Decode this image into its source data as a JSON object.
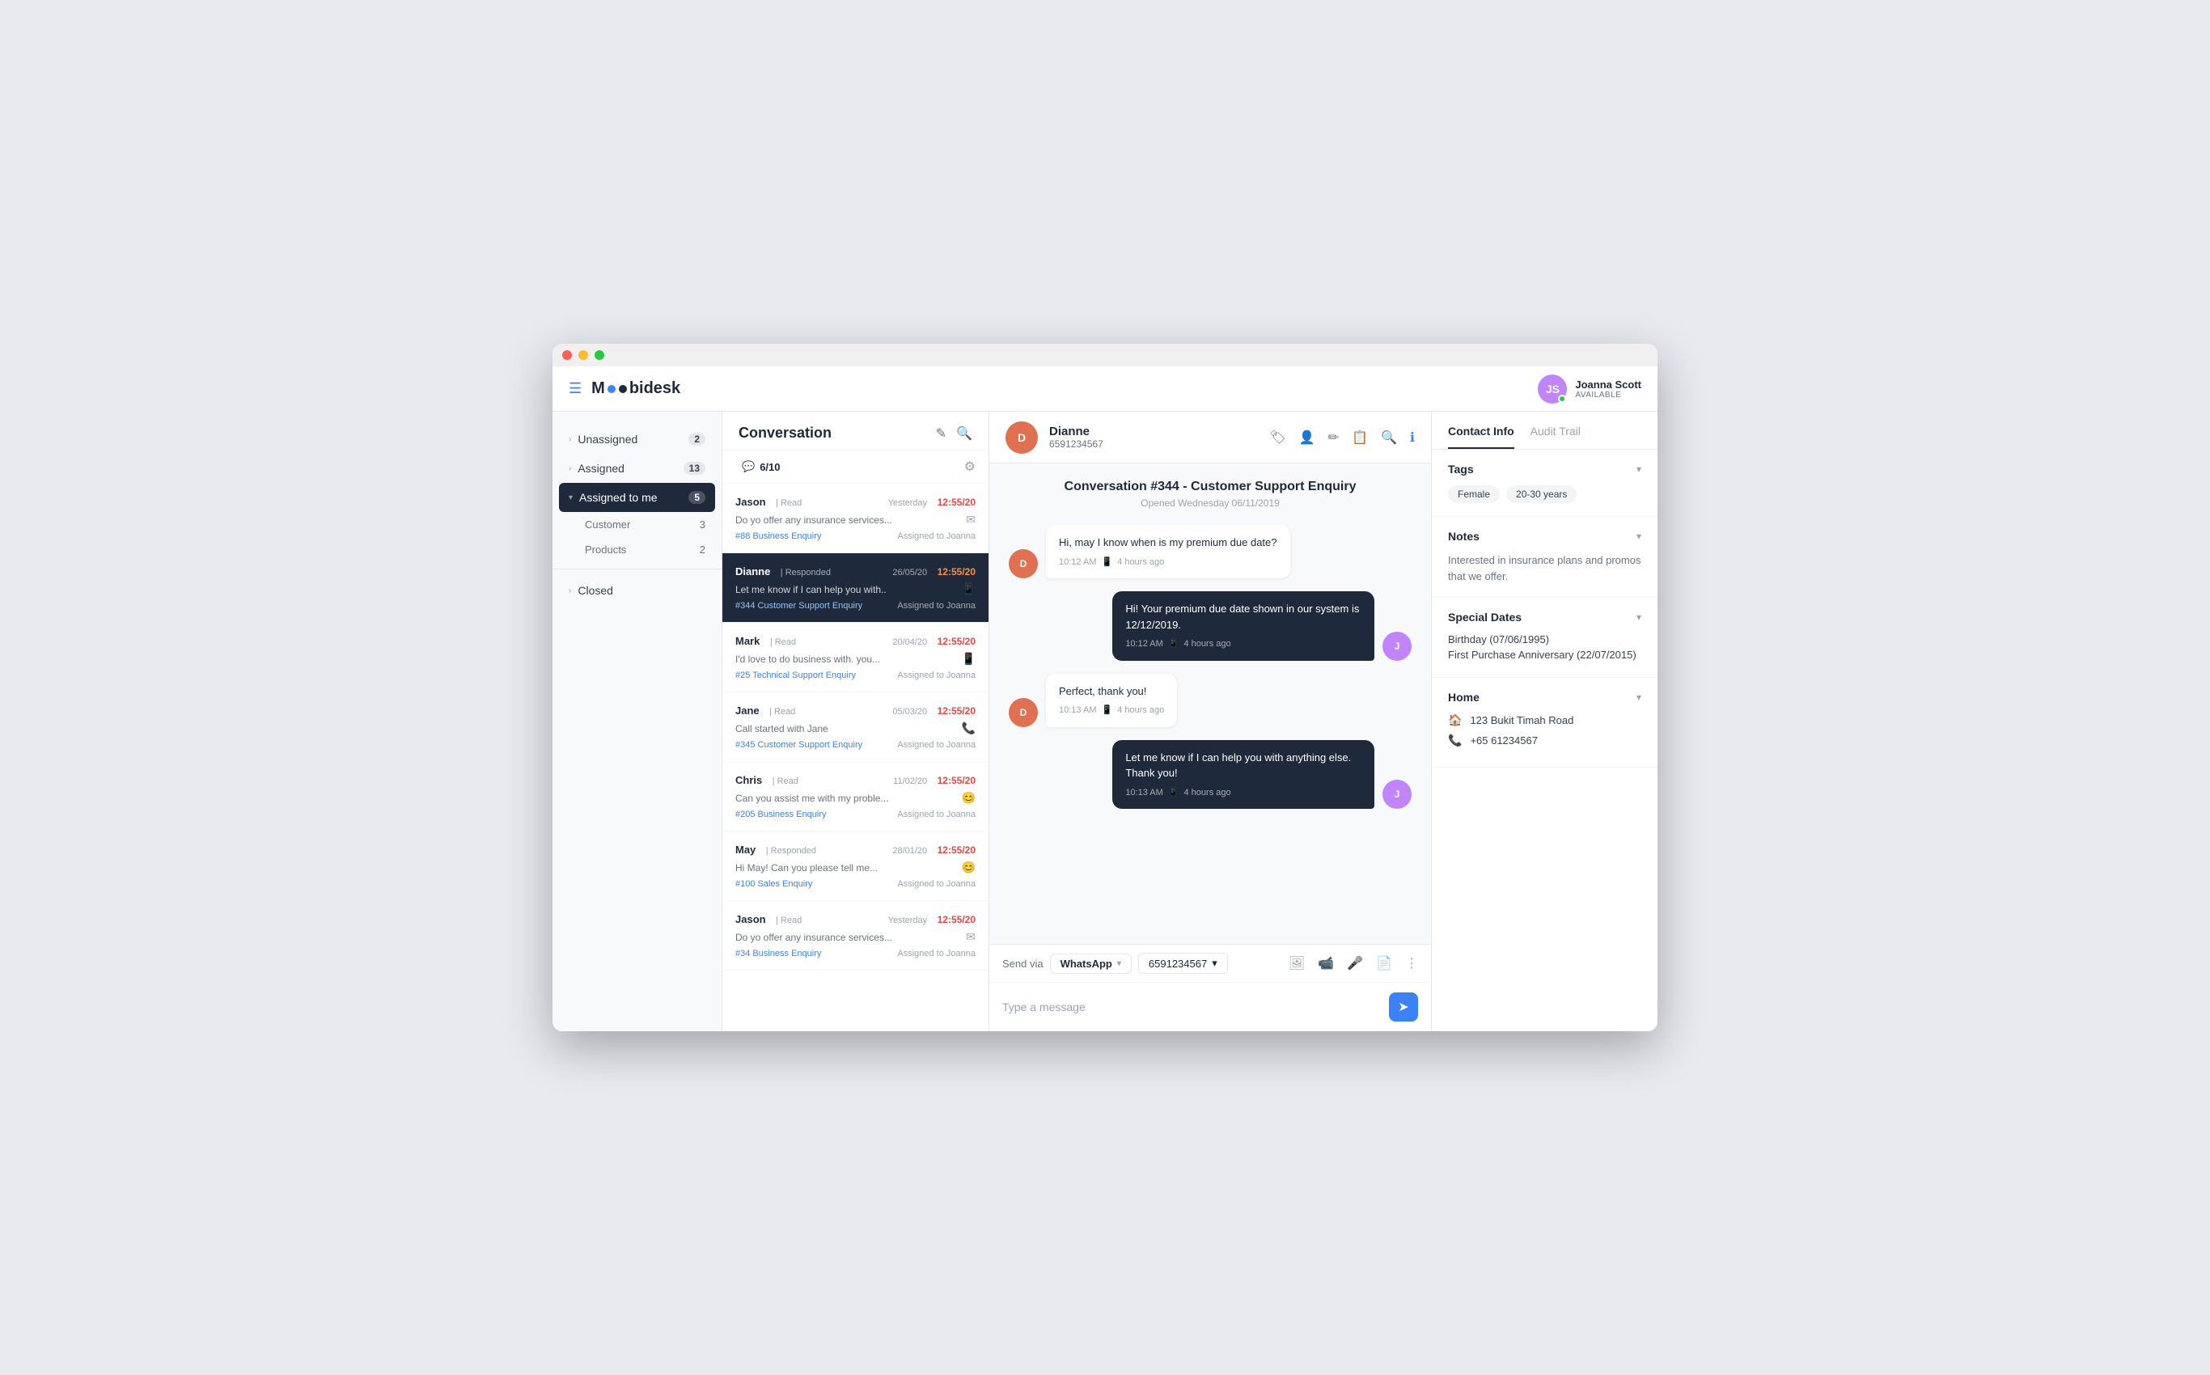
{
  "window": {
    "title": "Moobidesk"
  },
  "header": {
    "logo_text": "Moobidesk",
    "user_name": "Joanna Scott",
    "user_status": "AVAILABLE",
    "user_initials": "JS"
  },
  "sidebar": {
    "items": [
      {
        "id": "unassigned",
        "label": "Unassigned",
        "count": "2",
        "active": false
      },
      {
        "id": "assigned",
        "label": "Assigned",
        "count": "13",
        "active": false
      },
      {
        "id": "assigned-to-me",
        "label": "Assigned to me",
        "count": "5",
        "active": true
      },
      {
        "id": "closed",
        "label": "Closed",
        "count": "",
        "active": false
      }
    ],
    "sub_items": [
      {
        "id": "customer",
        "label": "Customer",
        "count": "3"
      },
      {
        "id": "products",
        "label": "Products",
        "count": "2"
      }
    ]
  },
  "conversation_list": {
    "title": "Conversation",
    "tab_count": "6/10",
    "items": [
      {
        "id": "conv-1",
        "name": "Jason",
        "status": "Read",
        "date": "Yesterday",
        "time": "12:55/20",
        "preview": "Do yo offer any insurance services...",
        "icon": "email",
        "tag": "#88 Business Enquiry",
        "assigned": "Assigned to Joanna",
        "selected": false
      },
      {
        "id": "conv-2",
        "name": "Dianne",
        "status": "Responded",
        "date": "26/05/20",
        "time": "12:55/20",
        "preview": "Let me know if I can help you with..",
        "icon": "whatsapp",
        "tag": "#344 Customer Support Enquiry",
        "assigned": "Assigned to Joanna",
        "selected": true
      },
      {
        "id": "conv-3",
        "name": "Mark",
        "status": "Read",
        "date": "20/04/20",
        "time": "12:55/20",
        "preview": "I'd love to do business with. you...",
        "icon": "phone",
        "tag": "#25 Technical Support Enquiry",
        "assigned": "Assigned to Joanna",
        "selected": false
      },
      {
        "id": "conv-4",
        "name": "Jane",
        "status": "Read",
        "date": "05/03/20",
        "time": "12:55/20",
        "preview": "Call started with Jane",
        "icon": "phone",
        "tag": "#345 Customer Support Enquiry",
        "assigned": "Assigned to Joanna",
        "selected": false
      },
      {
        "id": "conv-5",
        "name": "Chris",
        "status": "Read",
        "date": "11/02/20",
        "time": "12:55/20",
        "preview": "Can you assist me with my proble...",
        "icon": "emoji",
        "tag": "#205 Business Enquiry",
        "assigned": "Assigned to Joanna",
        "selected": false
      },
      {
        "id": "conv-6",
        "name": "May",
        "status": "Responded",
        "date": "28/01/20",
        "time": "12:55/20",
        "preview": "Hi May! Can you please tell me...",
        "icon": "emoji",
        "tag": "#100 Sales Enquiry",
        "assigned": "Assigned to Joanna",
        "selected": false
      },
      {
        "id": "conv-7",
        "name": "Jason",
        "status": "Read",
        "date": "Yesterday",
        "time": "12:55/20",
        "preview": "Do yo offer any insurance services...",
        "icon": "email",
        "tag": "#34 Business Enquiry",
        "assigned": "Assigned to Joanna",
        "selected": false
      }
    ]
  },
  "chat": {
    "contact_name": "Dianne",
    "contact_phone": "6591234567",
    "contact_initials": "D",
    "conversation_title": "Conversation #344 - Customer Support Enquiry",
    "conversation_date": "Opened Wednesday 06/11/2019",
    "messages": [
      {
        "id": "msg-1",
        "direction": "incoming",
        "text": "Hi, may I know when is my premium due date?",
        "time": "10:12 AM",
        "channel": "whatsapp",
        "time_ago": "4 hours ago"
      },
      {
        "id": "msg-2",
        "direction": "outgoing",
        "text": "Hi! Your premium due date shown in our system is 12/12/2019.",
        "time": "10:12 AM",
        "channel": "whatsapp",
        "time_ago": "4 hours ago"
      },
      {
        "id": "msg-3",
        "direction": "incoming",
        "text": "Perfect, thank you!",
        "time": "10:13 AM",
        "channel": "whatsapp",
        "time_ago": "4 hours ago"
      },
      {
        "id": "msg-4",
        "direction": "outgoing",
        "text": "Let me know if I can help you with anything else. Thank you!",
        "time": "10:13 AM",
        "channel": "whatsapp",
        "time_ago": "4 hours ago"
      }
    ],
    "send_via_label": "Send via",
    "channel": "WhatsApp",
    "phone": "6591234567",
    "input_placeholder": "Type a message"
  },
  "right_panel": {
    "tabs": [
      {
        "id": "contact-info",
        "label": "Contact Info",
        "active": true
      },
      {
        "id": "audit-trail",
        "label": "Audit Trail",
        "active": false
      }
    ],
    "tags": {
      "title": "Tags",
      "items": [
        "Female",
        "20-30 years"
      ]
    },
    "notes": {
      "title": "Notes",
      "text": "Interested in insurance plans and promos that we offer."
    },
    "special_dates": {
      "title": "Special Dates",
      "items": [
        "Birthday (07/06/1995)",
        "First Purchase Anniversary (22/07/2015)"
      ]
    },
    "home": {
      "title": "Home",
      "address": "123 Bukit Timah Road",
      "phone": "+65 61234567"
    }
  }
}
